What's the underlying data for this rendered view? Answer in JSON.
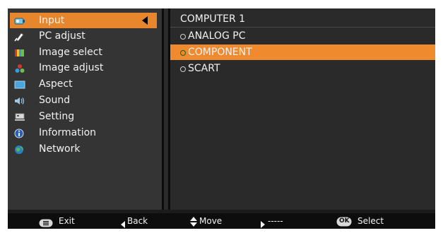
{
  "menu": {
    "items": [
      {
        "label": "Input",
        "icon": "input-icon",
        "selected": true
      },
      {
        "label": "PC adjust",
        "icon": "pc-adjust-icon"
      },
      {
        "label": "Image select",
        "icon": "image-select-icon"
      },
      {
        "label": "Image adjust",
        "icon": "image-adjust-icon"
      },
      {
        "label": "Aspect",
        "icon": "aspect-icon"
      },
      {
        "label": "Sound",
        "icon": "sound-icon"
      },
      {
        "label": "Setting",
        "icon": "setting-icon"
      },
      {
        "label": "Information",
        "icon": "information-icon"
      },
      {
        "label": "Network",
        "icon": "network-icon"
      }
    ]
  },
  "submenu": {
    "title": "COMPUTER 1",
    "options": [
      {
        "label": "ANALOG PC",
        "selected": false
      },
      {
        "label": "COMPONENT",
        "selected": true
      },
      {
        "label": "SCART",
        "selected": false
      }
    ]
  },
  "footer": {
    "exit_label": "Exit",
    "back_label": "Back",
    "move_label": "Move",
    "next_label": "-----",
    "select_label": "Select",
    "ok_label": "OK"
  },
  "colors": {
    "accent": "#ef8a2e",
    "panel": "#343434",
    "subpanel": "#2a2a2a"
  }
}
